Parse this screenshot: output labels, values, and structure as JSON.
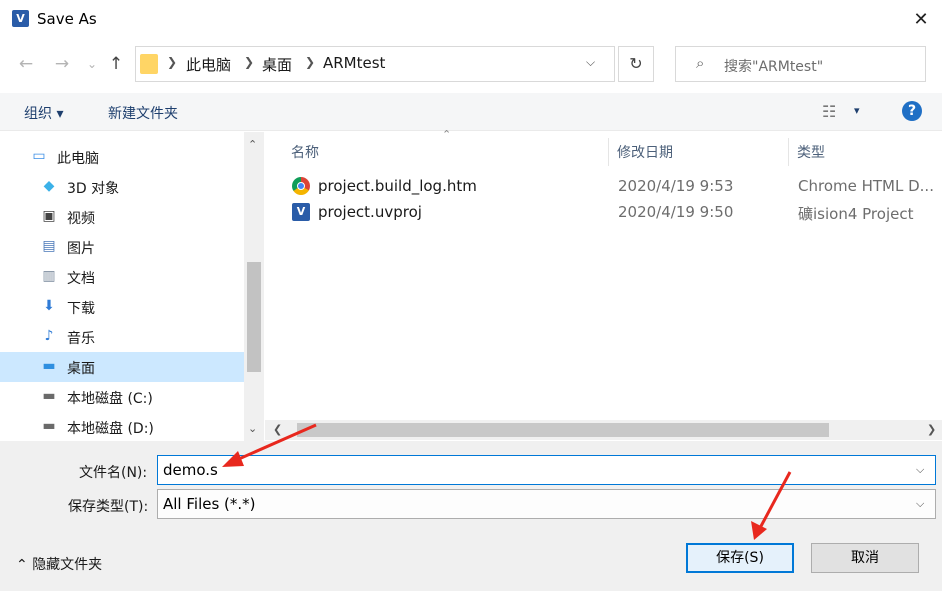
{
  "window": {
    "title": "Save As",
    "close": "✕"
  },
  "nav": {
    "back": "←",
    "forward": "→",
    "recent": "⌄",
    "up": "↑",
    "breadcrumb": [
      "此电脑",
      "桌面",
      "ARMtest"
    ],
    "refresh": "↻",
    "search_placeholder": "搜索\"ARMtest\""
  },
  "toolbar": {
    "organize": "组织 ▾",
    "new_folder": "新建文件夹",
    "view_dd": "▾",
    "help": "?"
  },
  "tree": [
    {
      "label": "此电脑",
      "icon": "computer-icon"
    },
    {
      "label": "3D 对象",
      "icon": "3d-objects-icon"
    },
    {
      "label": "视频",
      "icon": "video-icon"
    },
    {
      "label": "图片",
      "icon": "pictures-icon"
    },
    {
      "label": "文档",
      "icon": "documents-icon"
    },
    {
      "label": "下载",
      "icon": "download-icon"
    },
    {
      "label": "音乐",
      "icon": "music-icon"
    },
    {
      "label": "桌面",
      "icon": "desktop-icon",
      "selected": true
    },
    {
      "label": "本地磁盘 (C:)",
      "icon": "drive-c-icon"
    },
    {
      "label": "本地磁盘 (D:)",
      "icon": "drive-d-icon"
    }
  ],
  "columns": {
    "name": "名称",
    "date": "修改日期",
    "type": "类型"
  },
  "files": [
    {
      "name": "project.build_log.htm",
      "date": "2020/4/19 9:53",
      "type": "Chrome HTML D...",
      "icon": "chrome-icon"
    },
    {
      "name": "project.uvproj",
      "date": "2020/4/19 9:50",
      "type": "礦ision4 Project",
      "icon": "uvision-icon"
    }
  ],
  "form": {
    "filename_label": "文件名(N):",
    "filename_value": "demo.s",
    "filetype_label": "保存类型(T):",
    "filetype_value": "All Files (*.*)"
  },
  "footer": {
    "hide_folders": "隐藏文件夹",
    "save": "保存(S)",
    "cancel": "取消"
  },
  "colors": {
    "accent": "#0078d7",
    "selection": "#cce8ff",
    "annotation": "#e8281e"
  }
}
